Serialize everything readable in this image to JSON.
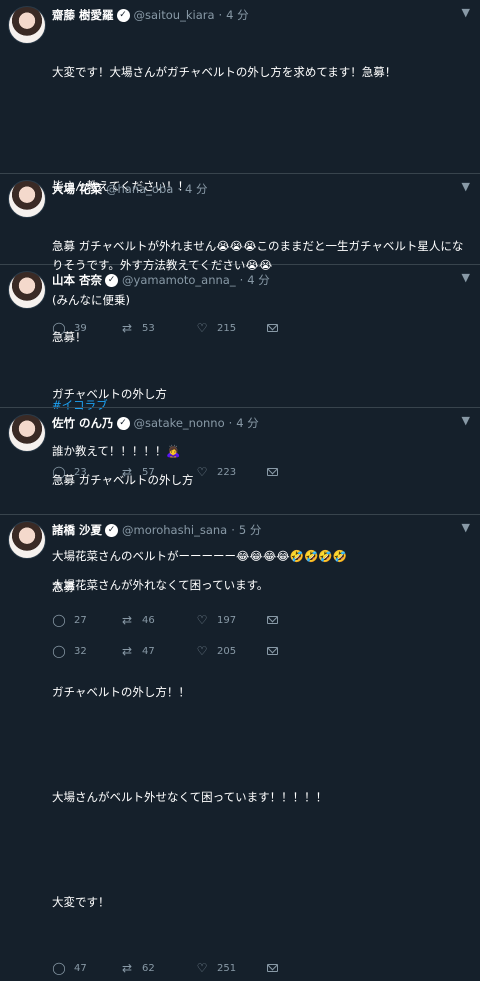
{
  "tweets": [
    {
      "name": "齋藤 樹愛羅",
      "handle": "@saitou_kiara",
      "time": "4 分",
      "lines": [
        "大変です！大場さんがガチャベルトの外し方を求めてます！急募！",
        "",
        "皆さん教えてください！！",
        "",
        "(みんなに便乗)",
        ""
      ],
      "hashtag": "#イコラブ",
      "replies": "23",
      "retweets": "57",
      "likes": "223"
    },
    {
      "name": "大場 花菜",
      "handle": "@hana_oba",
      "time": "4 分",
      "lines": [
        "急募 ガチャベルトが外れません😭😭😭このままだと一生ガチャベルト星人になりそうです。外す方法教えてください😭😭"
      ],
      "replies": "39",
      "retweets": "53",
      "likes": "215"
    },
    {
      "name": "山本 杏奈",
      "handle": "@yamamoto_anna_",
      "time": "4 分",
      "lines": [
        "急募！",
        "ガチャベルトの外し方",
        "誰か教えて！！！！！🙇‍♀️",
        "",
        "大場花菜さんのベルトがーーーーー😂😂😂😂🤣🤣🤣🤣"
      ],
      "replies": "27",
      "retweets": "46",
      "likes": "197"
    },
    {
      "name": "佐竹 のん乃",
      "handle": "@satake_nonno",
      "time": "4 分",
      "lines": [
        "急募 ガチャベルトの外し方",
        "",
        "大場花菜さんが外れなくて困っています。"
      ],
      "replies": "32",
      "retweets": "47",
      "likes": "205"
    },
    {
      "name": "諸橋 沙夏",
      "handle": "@morohashi_sana",
      "time": "5 分",
      "lines": [
        "急募",
        "",
        "ガチャベルトの外し方！！",
        "",
        "大場さんがベルト外せなくて困っています！！！！！",
        "",
        "大変です！"
      ],
      "replies": "47",
      "retweets": "62",
      "likes": "251"
    }
  ],
  "icons": {
    "reply": "reply-icon",
    "retweet": "retweet-icon",
    "like": "heart-icon",
    "dm": "mail-icon",
    "menu": "chevron-down-icon",
    "verified": "verified-badge-icon"
  },
  "colors": {
    "background": "#15202b",
    "text": "#ffffff",
    "muted": "#8899a6",
    "link": "#1da1f2",
    "divider": "#38444d"
  }
}
